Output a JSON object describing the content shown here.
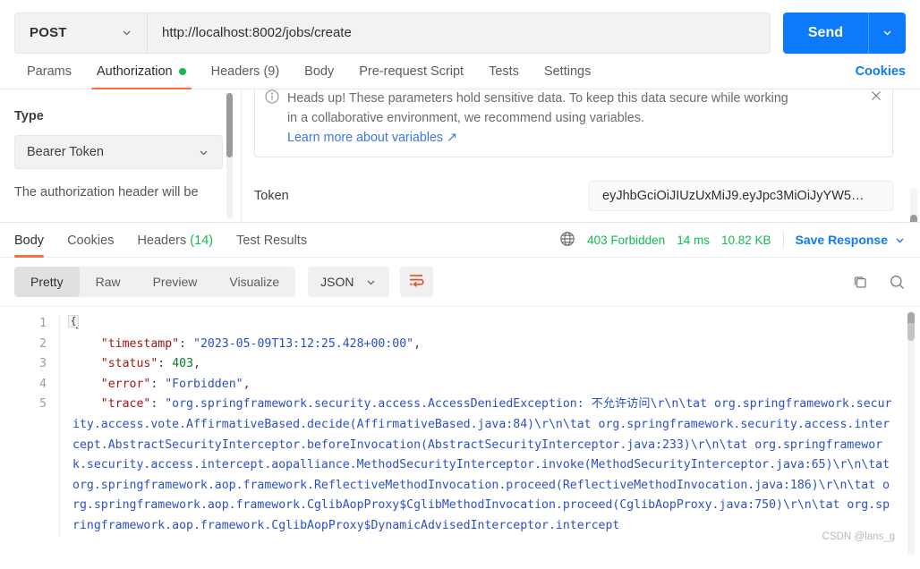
{
  "request": {
    "method": "POST",
    "url": "http://localhost:8002/jobs/create",
    "send_label": "Send",
    "tabs": [
      {
        "label": "Params",
        "active": false,
        "dot": false
      },
      {
        "label": "Authorization",
        "active": true,
        "dot": true
      },
      {
        "label": "Headers (9)",
        "active": false,
        "dot": false
      },
      {
        "label": "Body",
        "active": false,
        "dot": false
      },
      {
        "label": "Pre-request Script",
        "active": false,
        "dot": false
      },
      {
        "label": "Tests",
        "active": false,
        "dot": false
      },
      {
        "label": "Settings",
        "active": false,
        "dot": false
      }
    ],
    "cookies_label": "Cookies"
  },
  "auth": {
    "type_label": "Type",
    "type_value": "Bearer Token",
    "note": "The authorization header will be",
    "banner": {
      "line1": "Heads up! These parameters hold sensitive data. To keep this data secure while working",
      "line2": "in a collaborative environment, we recommend using variables.",
      "link": "Learn more about variables ↗"
    },
    "token_label": "Token",
    "token_value": "eyJhbGciOiJIUzUxMiJ9.eyJpc3MiOiJyYW5…"
  },
  "response": {
    "tabs": [
      {
        "label": "Body",
        "active": true
      },
      {
        "label": "Cookies",
        "active": false
      },
      {
        "label": "Headers",
        "active": false,
        "count": "(14)"
      },
      {
        "label": "Test Results",
        "active": false
      }
    ],
    "status": "403 Forbidden",
    "time": "14 ms",
    "size": "10.82 KB",
    "save_label": "Save Response",
    "view_modes": [
      {
        "label": "Pretty",
        "active": true
      },
      {
        "label": "Raw",
        "active": false
      },
      {
        "label": "Preview",
        "active": false
      },
      {
        "label": "Visualize",
        "active": false
      }
    ],
    "format": "JSON"
  },
  "body": {
    "line_numbers": [
      "1",
      "2",
      "3",
      "4",
      "5"
    ],
    "fold_glyph": "{",
    "json": {
      "open_brace": "{",
      "entries": [
        {
          "key": "\"timestamp\"",
          "sep": ": ",
          "value": "\"2023-05-09T13:12:25.428+00:00\"",
          "comma": ",",
          "type": "string"
        },
        {
          "key": "\"status\"",
          "sep": ": ",
          "value": "403",
          "comma": ",",
          "type": "number"
        },
        {
          "key": "\"error\"",
          "sep": ": ",
          "value": "\"Forbidden\"",
          "comma": ",",
          "type": "string"
        },
        {
          "key": "\"trace\"",
          "sep": ": ",
          "value": "\"org.springframework.security.access.AccessDeniedException: 不允许访问\\r\\n\\tat org.springframework.security.access.vote.AffirmativeBased.decide(AffirmativeBased.java:84)\\r\\n\\tat org.springframework.security.access.intercept.AbstractSecurityInterceptor.beforeInvocation(AbstractSecurityInterceptor.java:233)\\r\\n\\tat org.springframework.security.access.intercept.aopalliance.MethodSecurityInterceptor.invoke(MethodSecurityInterceptor.java:65)\\r\\n\\tat org.springframework.aop.framework.ReflectiveMethodInvocation.proceed(ReflectiveMethodInvocation.java:186)\\r\\n\\tat org.springframework.aop.framework.CglibAopProxy$CglibMethodInvocation.proceed(CglibAopProxy.java:750)\\r\\n\\tat org.springframework.aop.framework.CglibAopProxy$DynamicAdvisedInterceptor.intercept",
          "comma": "",
          "type": "string"
        }
      ]
    }
  },
  "watermark": "CSDN @lans_g",
  "colors": {
    "accent_orange": "#ff6c37",
    "brand_blue": "#0d7afc",
    "success_green": "#0cbb52",
    "json_key": "#a31515",
    "json_string": "#2b50c8",
    "json_number": "#0a7d28"
  }
}
